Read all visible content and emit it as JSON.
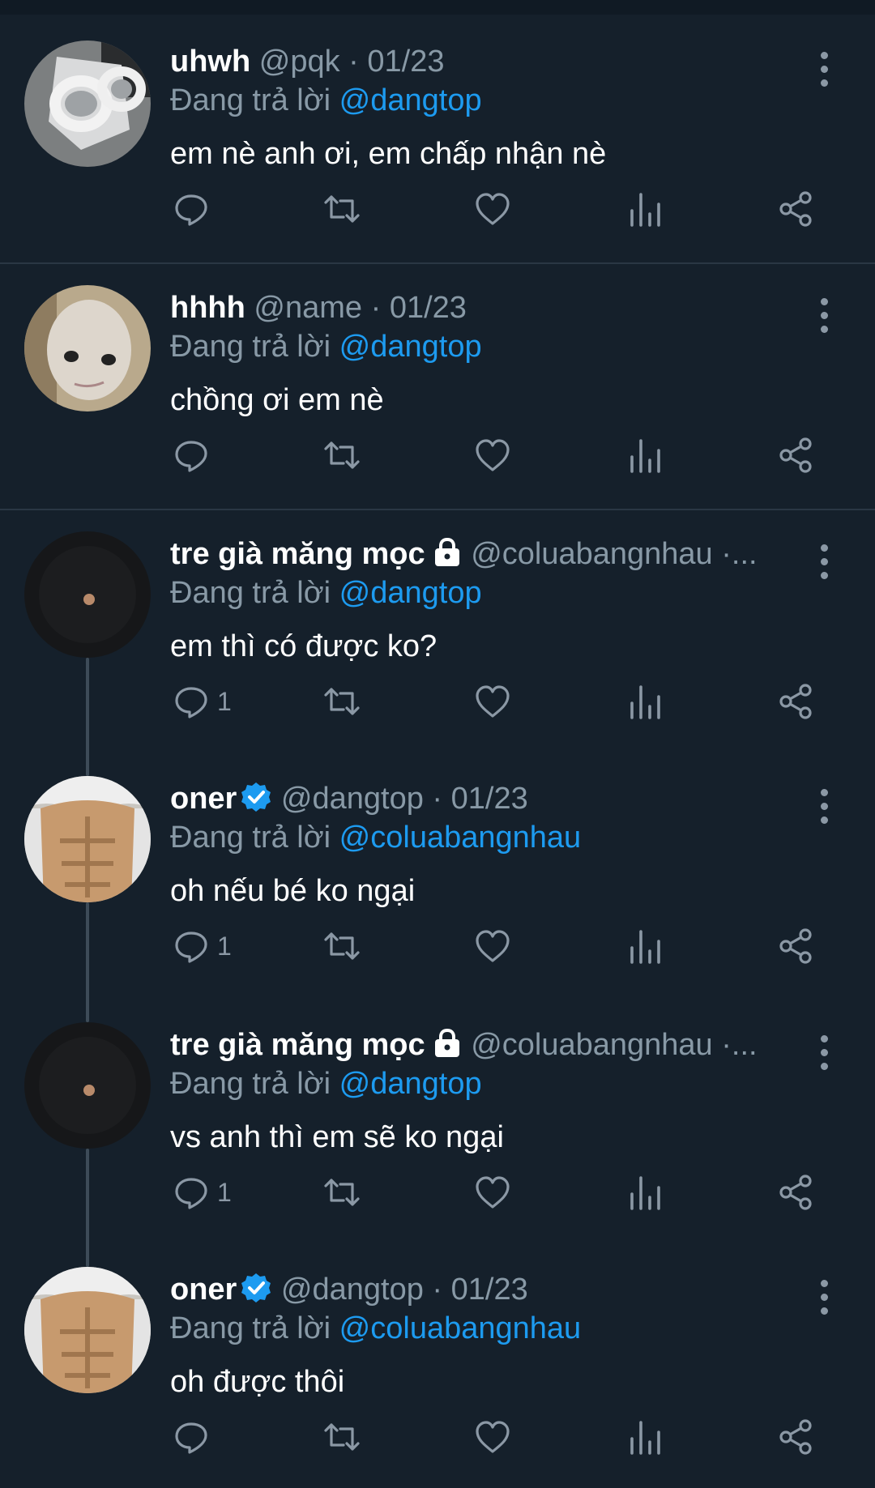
{
  "theme": {
    "background": "#15202b",
    "text": "#ffffff",
    "secondary": "#8899a6",
    "accent": "#1d9bf0",
    "verified": "#1d9bf0"
  },
  "replying_label": "Đang trả lời",
  "tweets": [
    {
      "name": "uhwh",
      "handle": "@pqk · 01/23",
      "replying_to": "@dangtop",
      "text": "em nè anh ơi, em chấp nhận nè",
      "reply_count": "",
      "verified": false,
      "locked": false,
      "avatar_icon": "sunglasses-avatar"
    },
    {
      "name": "hhhh",
      "handle": "@name · 01/23",
      "replying_to": "@dangtop",
      "text": "chồng ơi em nè",
      "reply_count": "",
      "verified": false,
      "locked": false,
      "avatar_icon": "face-avatar"
    },
    {
      "name": "tre già măng mọc",
      "handle": "@coluabangnhau ·...",
      "replying_to": "@dangtop",
      "text": "em thì có được ko?",
      "reply_count": "1",
      "verified": false,
      "locked": true,
      "avatar_icon": "moon-avatar"
    },
    {
      "name": "oner",
      "handle": "@dangtop · 01/23",
      "replying_to": "@coluabangnhau",
      "text": "oh nếu bé ko ngại",
      "reply_count": "1",
      "verified": true,
      "locked": false,
      "avatar_icon": "abs-avatar"
    },
    {
      "name": "tre già măng mọc",
      "handle": "@coluabangnhau ·...",
      "replying_to": "@dangtop",
      "text": "vs anh thì em sẽ ko ngại",
      "reply_count": "1",
      "verified": false,
      "locked": true,
      "avatar_icon": "moon-avatar"
    },
    {
      "name": "oner",
      "handle": "@dangtop · 01/23",
      "replying_to": "@coluabangnhau",
      "text": "oh được thôi",
      "reply_count": "",
      "verified": true,
      "locked": false,
      "avatar_icon": "abs-avatar"
    }
  ]
}
